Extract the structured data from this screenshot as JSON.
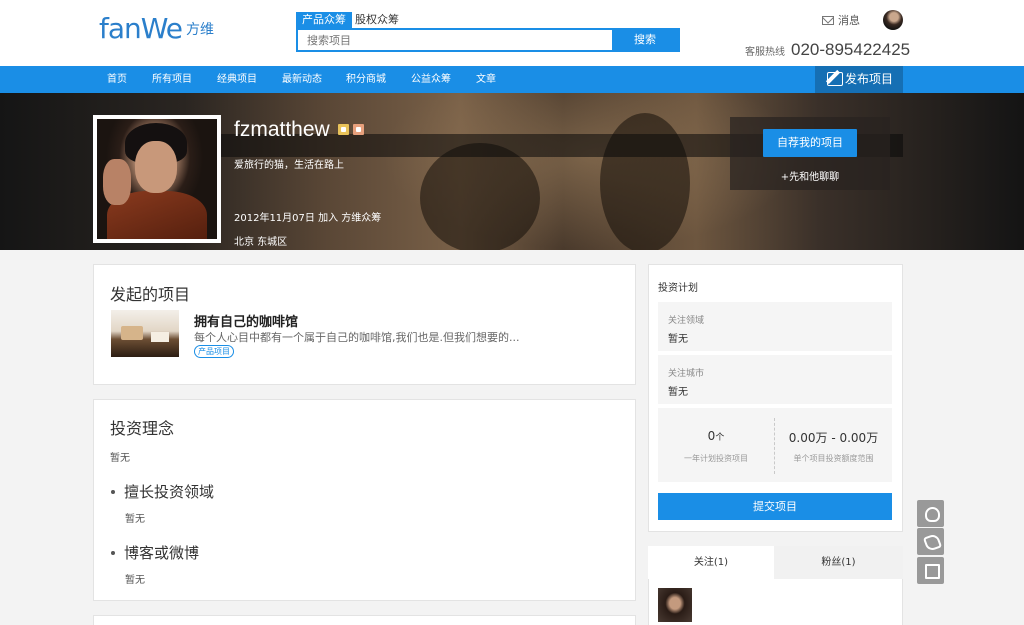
{
  "header": {
    "logo_text": "fanWe",
    "logo_cn": "方维",
    "search_tabs": [
      "产品众筹",
      "股权众筹"
    ],
    "search_placeholder": "搜索项目",
    "search_button": "搜索",
    "message_label": "消息",
    "hotline_label": "客服热线",
    "hotline_number": "020-895422425"
  },
  "nav": {
    "items": [
      "首页",
      "所有项目",
      "经典项目",
      "最新动态",
      "积分商城",
      "公益众筹",
      "文章"
    ],
    "publish_label": "发布项目"
  },
  "profile": {
    "username": "fzmatthew",
    "bio": "爱旅行的猫，生活在路上",
    "joined": "2012年11月07日 加入 方维众筹",
    "location": "北京 东城区",
    "recommend_button": "自荐我的项目",
    "chat_link": "+先和他聊聊"
  },
  "projects": {
    "title": "发起的项目",
    "items": [
      {
        "name": "拥有自己的咖啡馆",
        "desc": "每个人心目中都有一个属于自己的咖啡馆,我们也是.但我们想要的...",
        "tag": "产品项目"
      }
    ]
  },
  "philosophy": {
    "title": "投资理念",
    "value": "暂无",
    "field_title": "擅长投资领域",
    "field_value": "暂无",
    "blog_title": "博客或微博",
    "blog_value": "暂无"
  },
  "plan": {
    "title": "投资计划",
    "focus_field_label": "关注领域",
    "focus_field_value": "暂无",
    "focus_city_label": "关注城市",
    "focus_city_value": "暂无",
    "count_value": "0",
    "count_unit": "个",
    "count_caption": "一年计划投资项目",
    "amount_value": "0.00万 - 0.00万",
    "amount_caption": "单个项目投资额度范围",
    "submit_button": "提交项目"
  },
  "social": {
    "follow_tab": "关注(1)",
    "fans_tab": "粉丝(1)"
  }
}
